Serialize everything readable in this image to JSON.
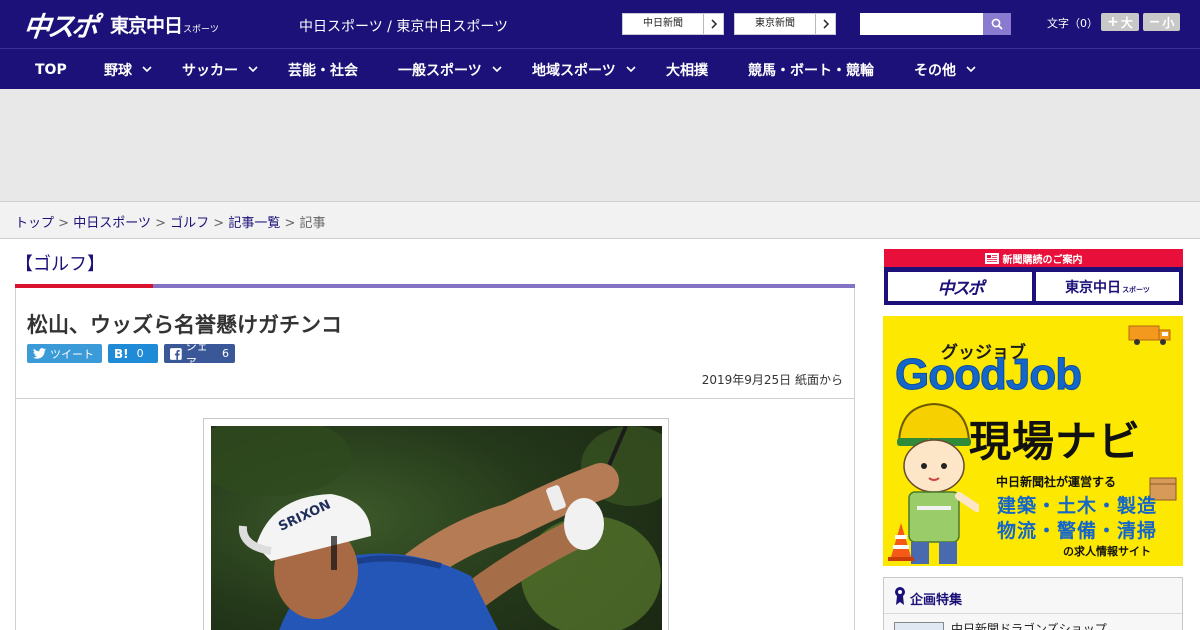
{
  "header": {
    "logo_main": "中スポ",
    "logo_sub": "東京中日",
    "logo_small": "スポーツ",
    "site_title": "中日スポーツ / 東京中日スポーツ",
    "ext_links": [
      "中日新聞",
      "東京新聞"
    ],
    "search_placeholder": "",
    "font_label": "文字（0）",
    "font_bigger": "大",
    "font_smaller": "小"
  },
  "nav": [
    {
      "label": "TOP",
      "dropdown": false
    },
    {
      "label": "野球",
      "dropdown": true
    },
    {
      "label": "サッカー",
      "dropdown": true
    },
    {
      "label": "芸能・社会",
      "dropdown": false
    },
    {
      "label": "一般スポーツ",
      "dropdown": true
    },
    {
      "label": "地域スポーツ",
      "dropdown": true
    },
    {
      "label": "大相撲",
      "dropdown": false
    },
    {
      "label": "競馬・ボート・競輪",
      "dropdown": false
    },
    {
      "label": "その他",
      "dropdown": true
    }
  ],
  "breadcrumb": {
    "links": [
      "トップ",
      "中日スポーツ",
      "ゴルフ",
      "記事一覧"
    ],
    "separator": ">",
    "current": "記事"
  },
  "article": {
    "section": "【ゴルフ】",
    "headline": "松山、ウッズら名誉懸けガチンコ",
    "share": {
      "twitter_label": "ツイート",
      "hatena_label": "B!",
      "hatena_count": "0",
      "facebook_label": "シェア",
      "facebook_count": "6"
    },
    "date": "2019年9月25日 紙面から"
  },
  "sidebar": {
    "subscribe_header": "新聞購読のご案内",
    "subscribe_chuspo": "中スポ",
    "subscribe_tokyo": "東京中日",
    "subscribe_tokyo_small": "スポーツ",
    "ad": {
      "kana": "グッジョブ",
      "logo": "GoodJob",
      "title": "現場ナビ",
      "operator": "中日新聞社が運営する",
      "jobs_line1": "建築・土木・製造",
      "jobs_line2": "物流・警備・清掃",
      "tagline": "の求人情報サイト"
    },
    "feature_title": "企画特集",
    "feature_item": "中日新聞ドラゴンズショップ"
  },
  "colors": {
    "brand_navy": "#1b1178",
    "accent_red": "#d8122f",
    "accent_purple": "#8473c4",
    "ad_yellow": "#fce800",
    "ad_blue": "#1466c8"
  }
}
